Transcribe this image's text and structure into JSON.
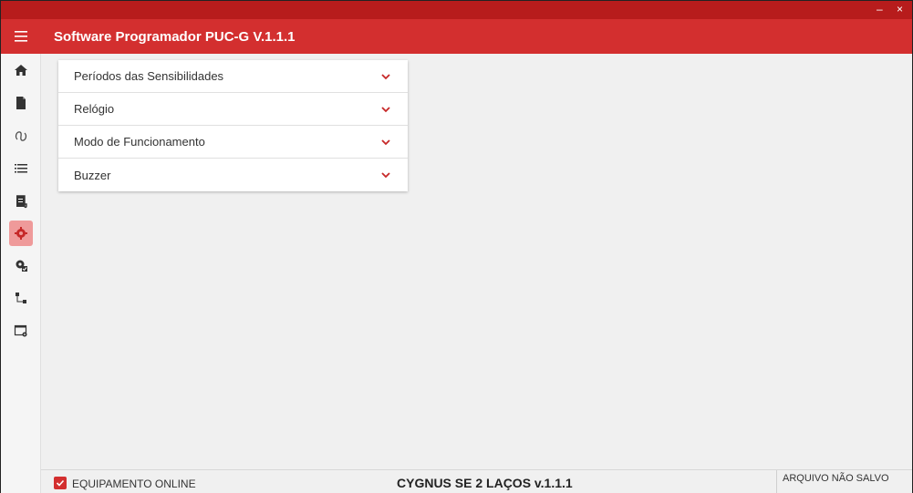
{
  "window": {
    "controls": "– ×"
  },
  "appbar": {
    "title": "Software Programador PUC-G V.1.1.1",
    "menu_icon": "hamburger-icon"
  },
  "sidebar": {
    "items": [
      {
        "icon": "home-icon",
        "active": false
      },
      {
        "icon": "file-icon",
        "active": false
      },
      {
        "icon": "loop-icon",
        "active": false
      },
      {
        "icon": "list-icon",
        "active": false
      },
      {
        "icon": "scroll-icon",
        "active": false
      },
      {
        "icon": "gear-icon",
        "active": true
      },
      {
        "icon": "gear-check-icon",
        "active": false
      },
      {
        "icon": "network-icon",
        "active": false
      },
      {
        "icon": "window-settings-icon",
        "active": false
      }
    ]
  },
  "accordion": {
    "items": [
      {
        "label": "Períodos das Sensibilidades"
      },
      {
        "label": "Relógio"
      },
      {
        "label": "Modo de Funcionamento"
      },
      {
        "label": "Buzzer"
      }
    ]
  },
  "status": {
    "online_label": "EQUIPAMENTO ONLINE",
    "online_checked": true,
    "device": "CYGNUS SE 2 LAÇOS v.1.1.1",
    "file_status": "ARQUIVO NÃO SALVO"
  },
  "colors": {
    "primary": "#d32f2f",
    "titlebar": "#b71c1c",
    "active_bg": "#ef9a9a"
  }
}
